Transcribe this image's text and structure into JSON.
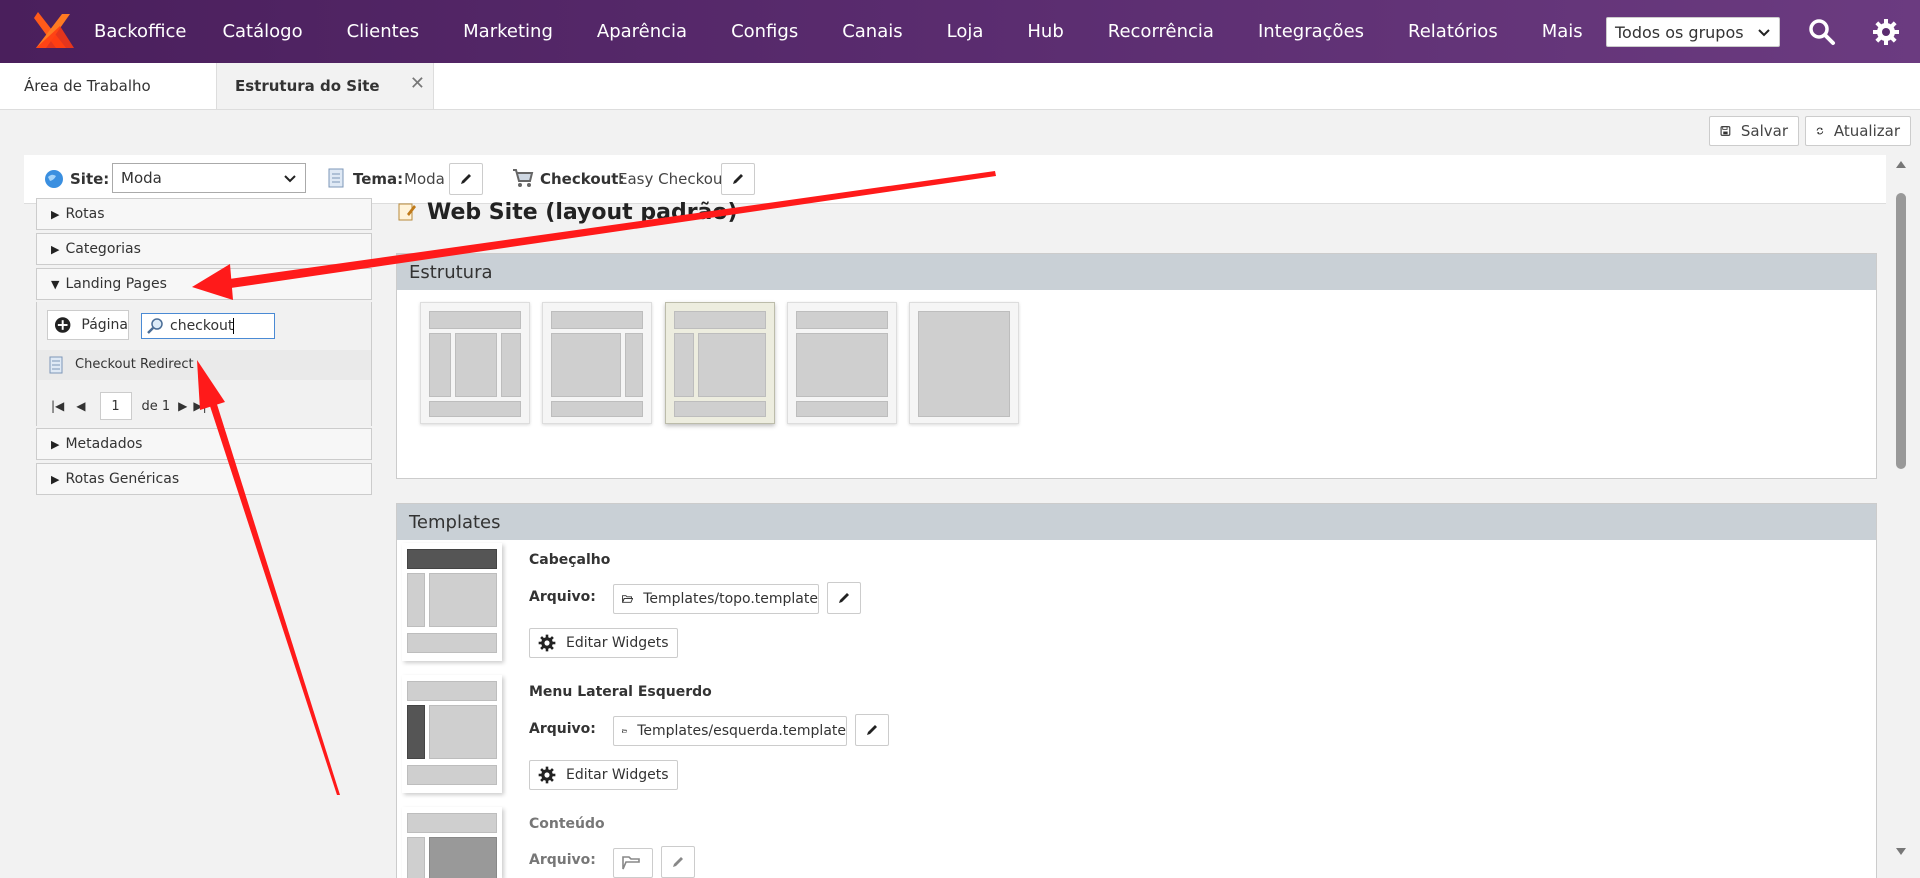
{
  "nav": {
    "brand": "Backoffice",
    "items": [
      "Catálogo",
      "Clientes",
      "Marketing",
      "Aparência",
      "Configs",
      "Canais",
      "Loja",
      "Hub",
      "Recorrência",
      "Integrações",
      "Relatórios",
      "Mais"
    ],
    "group_select": "Todos os grupos"
  },
  "tabs": {
    "desktop": "Área de Trabalho",
    "active": "Estrutura do Site"
  },
  "toolbar": {
    "save": "Salvar",
    "refresh": "Atualizar"
  },
  "sitebar": {
    "site_label": "Site:",
    "site_value": "Moda",
    "theme_label": "Tema:",
    "theme_value": "Moda",
    "checkout_label": "Checkout:",
    "checkout_value": "Easy Checkout"
  },
  "left": {
    "rotas": "Rotas",
    "categorias": "Categorias",
    "landing": "Landing Pages",
    "add_page": "Página",
    "search_value": "checkout",
    "result": "Checkout Redirect",
    "page_num": "1",
    "page_of": "de 1",
    "metadados": "Metadados",
    "rotas_gen": "Rotas Genéricas"
  },
  "main": {
    "title": "Web Site (layout padrão)",
    "estrutura": "Estrutura",
    "templates": "Templates",
    "tpls": [
      {
        "title": "Cabeçalho",
        "label": "Arquivo:",
        "file": "Templates/topo.template",
        "widgets": "Editar Widgets"
      },
      {
        "title": "Menu Lateral Esquerdo",
        "label": "Arquivo:",
        "file": "Templates/esquerda.template",
        "widgets": "Editar Widgets"
      },
      {
        "title": "Conteúdo",
        "label": "Arquivo:"
      }
    ]
  },
  "colors": {
    "nav_bg": "#5a2c6f",
    "section_head": "#c9d0d6",
    "arrow": "#ff1a1a"
  }
}
